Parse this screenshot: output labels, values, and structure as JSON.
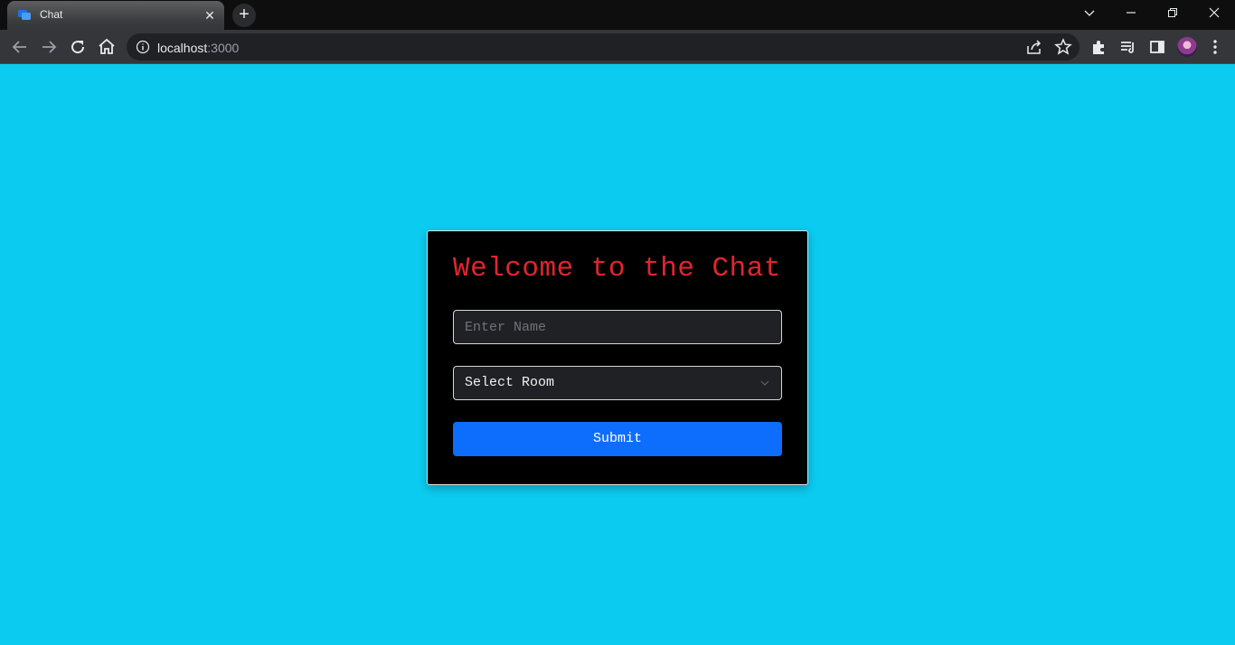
{
  "browser": {
    "tab": {
      "title": "Chat",
      "close_glyph": "✕"
    },
    "new_tab_glyph": "+",
    "url_host": "localhost",
    "url_port": ":3000",
    "window_controls": {
      "dropdown": "⌄",
      "minimize": "—",
      "restore": "❐",
      "close": "✕"
    }
  },
  "card": {
    "title": "Welcome to the Chat",
    "name_placeholder": "Enter Name",
    "room_select": "Select Room",
    "submit_label": "Submit"
  },
  "colors": {
    "page_bg": "#0ccbf0",
    "card_bg": "#000000",
    "title": "#e0252e",
    "submit_bg": "#0d6efd"
  }
}
